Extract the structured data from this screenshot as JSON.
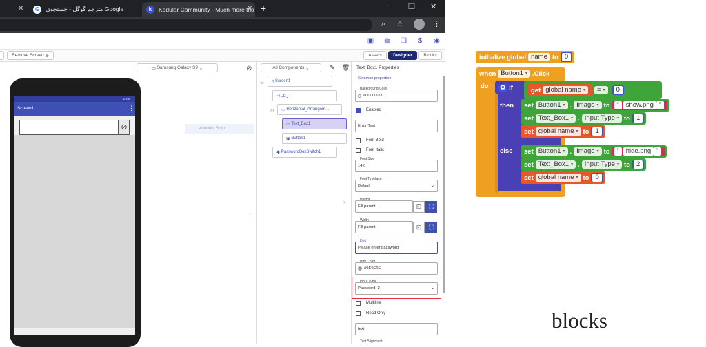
{
  "browser": {
    "tabs": [
      {
        "title": "مترجم گوگل - جستجوی Google",
        "favicon": "G"
      },
      {
        "title": "Kodular Community - Much more tha",
        "favicon": "k"
      }
    ],
    "new_tab": "+",
    "win_controls": [
      "−",
      "❐",
      "✕"
    ]
  },
  "app": {
    "remove_screen": "Remove Screen",
    "device": "Samsung Galaxy S9",
    "tabs": {
      "assets": "Assets",
      "designer": "Designer",
      "blocks": "Blocks"
    },
    "watermark": "Window Snip"
  },
  "phone": {
    "time": "12:00",
    "screen_title": "Screen1"
  },
  "components": {
    "header": "All Components",
    "items": [
      {
        "label": "Screen1",
        "icon": "phone-icon"
      },
      {
        "label": "رنگ",
        "icon": "variable-icon"
      },
      {
        "label": "Horizontal_Arrangem...",
        "icon": "arrangement-icon"
      },
      {
        "label": "Text_Box1",
        "icon": "textbox-icon"
      },
      {
        "label": "Button1",
        "icon": "button-icon"
      },
      {
        "label": "PasswordBoxSwitch1",
        "icon": "extension-icon"
      }
    ]
  },
  "properties": {
    "title": "Text_Box1 Properties",
    "section": "Common properties",
    "bg_label": "Background Color",
    "bg_value": "#00000000",
    "enabled": "Enabled",
    "error_text": "Error Text",
    "font_bold": "Font Bold",
    "font_italic": "Font Italic",
    "font_size_label": "Font Size",
    "font_size": "14.0",
    "typeface_label": "Font Typeface",
    "typeface": "Default",
    "height_label": "Height",
    "height": "Fill parent",
    "width_label": "Width",
    "width": "Fill parent",
    "hint_label": "Hint",
    "hint": "Please enter password",
    "hint_color_label": "Hint Color",
    "hint_color": "#9E9E9E",
    "input_type_label": "Input Type",
    "input_type": "Password: 2",
    "multiline": "Multiline",
    "read_only": "Read Only",
    "text": "text",
    "text_align_label": "Text Alignment"
  },
  "captions": {
    "designer": "designer",
    "blocks": "blocks"
  },
  "blocks": {
    "init": "initialize global",
    "var_name": "name",
    "to": "to",
    "init_value": "0",
    "when": "when",
    "button": "Button1",
    "click": ".Click",
    "do": "do",
    "if": "if",
    "get": "get",
    "global_name": "global name",
    "eq": "=",
    "cmp_value": "0",
    "then": "then",
    "else": "else",
    "set": "set",
    "image": "Image",
    "textbox": "Text_Box1",
    "input_type": "Input Type",
    "show": "show.png",
    "hide": "hide.png",
    "then_type": "1",
    "then_name": "1",
    "else_type": "2",
    "else_name": "0",
    "dot": "."
  }
}
